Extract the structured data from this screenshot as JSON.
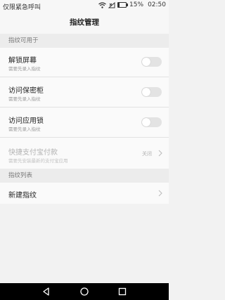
{
  "status": {
    "carrier": "仅限紧急呼叫",
    "battery": "15%",
    "time": "02:50"
  },
  "header": {
    "title": "指纹管理"
  },
  "sections": [
    {
      "title": "指纹可用于"
    },
    {
      "title": "指纹列表"
    }
  ],
  "items": [
    {
      "title": "解锁屏幕",
      "subtitle": "需要先录入指纹"
    },
    {
      "title": "访问保密柜",
      "subtitle": "需要先录入指纹"
    },
    {
      "title": "访问应用锁",
      "subtitle": "需要先录入指纹"
    },
    {
      "title": "快捷支付宝付款",
      "subtitle": "需要先安装最新的支付宝应用",
      "value": "关闭"
    }
  ],
  "fingerprint_list": {
    "new_label": "新建指纹"
  },
  "icons": {
    "wifi": "wifi-icon",
    "signal": "signal-icon",
    "battery": "battery-icon",
    "back": "back-icon",
    "home": "home-icon",
    "recent": "recent-apps-icon",
    "chevron": "chevron-right-icon"
  },
  "colors": {
    "background": "#f2f2f2",
    "toggle_off": "#e3e3e3",
    "navbar": "#000000"
  },
  "toggles": {
    "unlock_screen": false,
    "safe_box": false,
    "app_lock": false
  },
  "battery_level": 0.15
}
